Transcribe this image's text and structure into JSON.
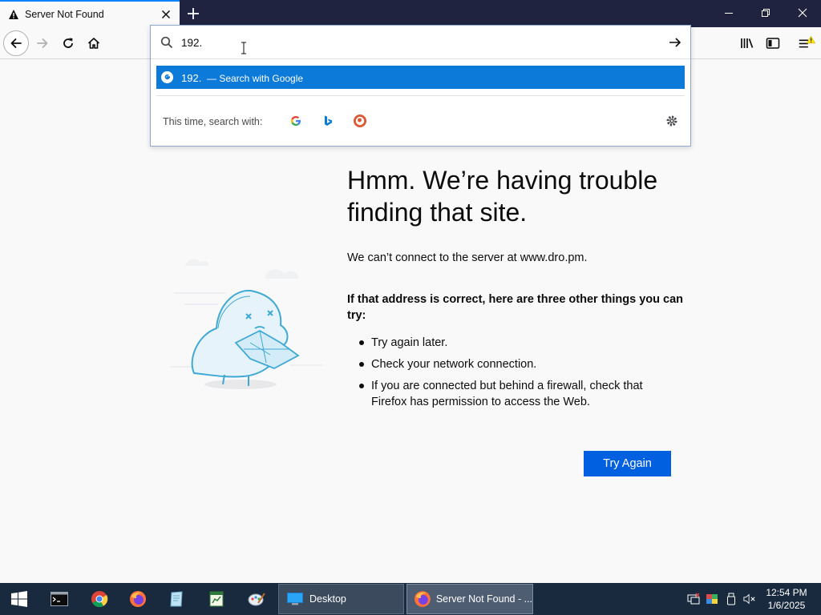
{
  "browser": {
    "tab": {
      "title": "Server Not Found"
    },
    "url_input": {
      "value": "192."
    },
    "suggestion": {
      "typed": "192.",
      "action": "— Search with Google"
    },
    "oneoff_label": "This time, search with:"
  },
  "error_page": {
    "title": "Hmm. We’re having trouble finding that site.",
    "message": "We can’t connect to the server at www.dro.pm.",
    "subtitle": "If that address is correct, here are three other things you can try:",
    "tips": [
      "Try again later.",
      "Check your network connection.",
      "If you are connected but behind a firewall, check that Firefox has permission to access the Web."
    ],
    "button": "Try Again"
  },
  "taskbar": {
    "windows": [
      {
        "label": "Desktop"
      },
      {
        "label": "Server Not Found - ..."
      }
    ],
    "clock": {
      "time": "12:54 PM",
      "date": "1/6/2025"
    }
  },
  "colors": {
    "accent": "#0060df",
    "suggestion_highlight": "#0b7ad8",
    "titlebar": "#202340",
    "taskbar": "#1a2a3e"
  }
}
